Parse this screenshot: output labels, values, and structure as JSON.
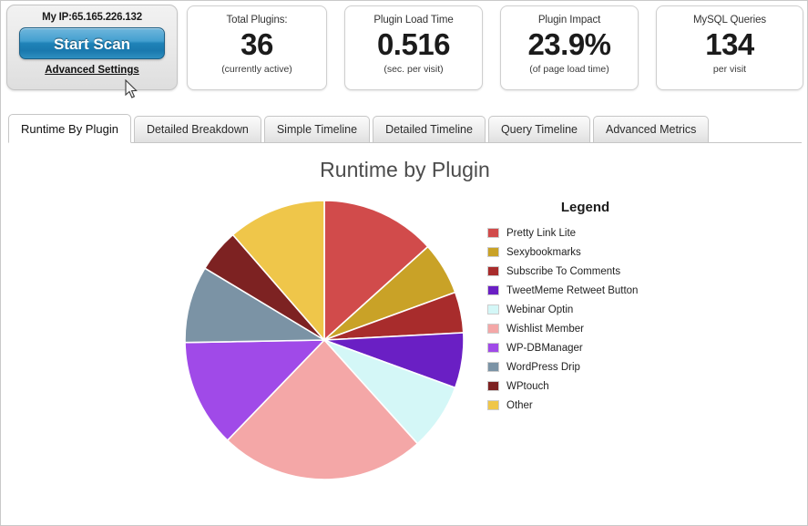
{
  "ip_panel": {
    "ip_text": "My IP:65.165.226.132",
    "scan_button": "Start Scan",
    "advanced_link": "Advanced Settings"
  },
  "stats": [
    {
      "label": "Total Plugins:",
      "value": "36",
      "sub": "(currently active)"
    },
    {
      "label": "Plugin Load Time",
      "value": "0.516",
      "sub": "(sec. per visit)"
    },
    {
      "label": "Plugin Impact",
      "value": "23.9%",
      "sub": "(of page load time)"
    },
    {
      "label": "MySQL Queries",
      "value": "134",
      "sub": "per visit"
    }
  ],
  "tabs": [
    {
      "label": "Runtime By Plugin",
      "active": true
    },
    {
      "label": "Detailed Breakdown",
      "active": false
    },
    {
      "label": "Simple Timeline",
      "active": false
    },
    {
      "label": "Detailed Timeline",
      "active": false
    },
    {
      "label": "Query Timeline",
      "active": false
    },
    {
      "label": "Advanced Metrics",
      "active": false
    }
  ],
  "tab_last": {
    "label": "Advanced Metrics"
  },
  "legend": {
    "title": "Legend"
  },
  "chart_data": {
    "type": "pie",
    "title": "Runtime by Plugin",
    "legend_position": "right",
    "start_angle": 0,
    "direction": "clockwise",
    "categories": [
      "Pretty Link Lite",
      "Sexybookmarks",
      "Subscribe To Comments",
      "TweetMeme Retweet Button",
      "Webinar Optin",
      "Wishlist Member",
      "WP-DBManager",
      "WordPress Drip",
      "WPtouch",
      "Other"
    ],
    "colors": [
      "#d14b4b",
      "#c9a227",
      "#a82c2c",
      "#6a1fc4",
      "#d4f7f7",
      "#f4a7a7",
      "#a04ae8",
      "#7b93a5",
      "#7d2222",
      "#efc64a"
    ],
    "angles_deg": [
      48,
      22,
      17,
      23,
      28,
      86,
      45,
      32,
      18,
      41
    ],
    "values": [
      13.3,
      6.1,
      4.7,
      6.4,
      7.8,
      23.9,
      12.5,
      8.9,
      5.0,
      11.4
    ],
    "ylabel": "",
    "xlabel": ""
  }
}
